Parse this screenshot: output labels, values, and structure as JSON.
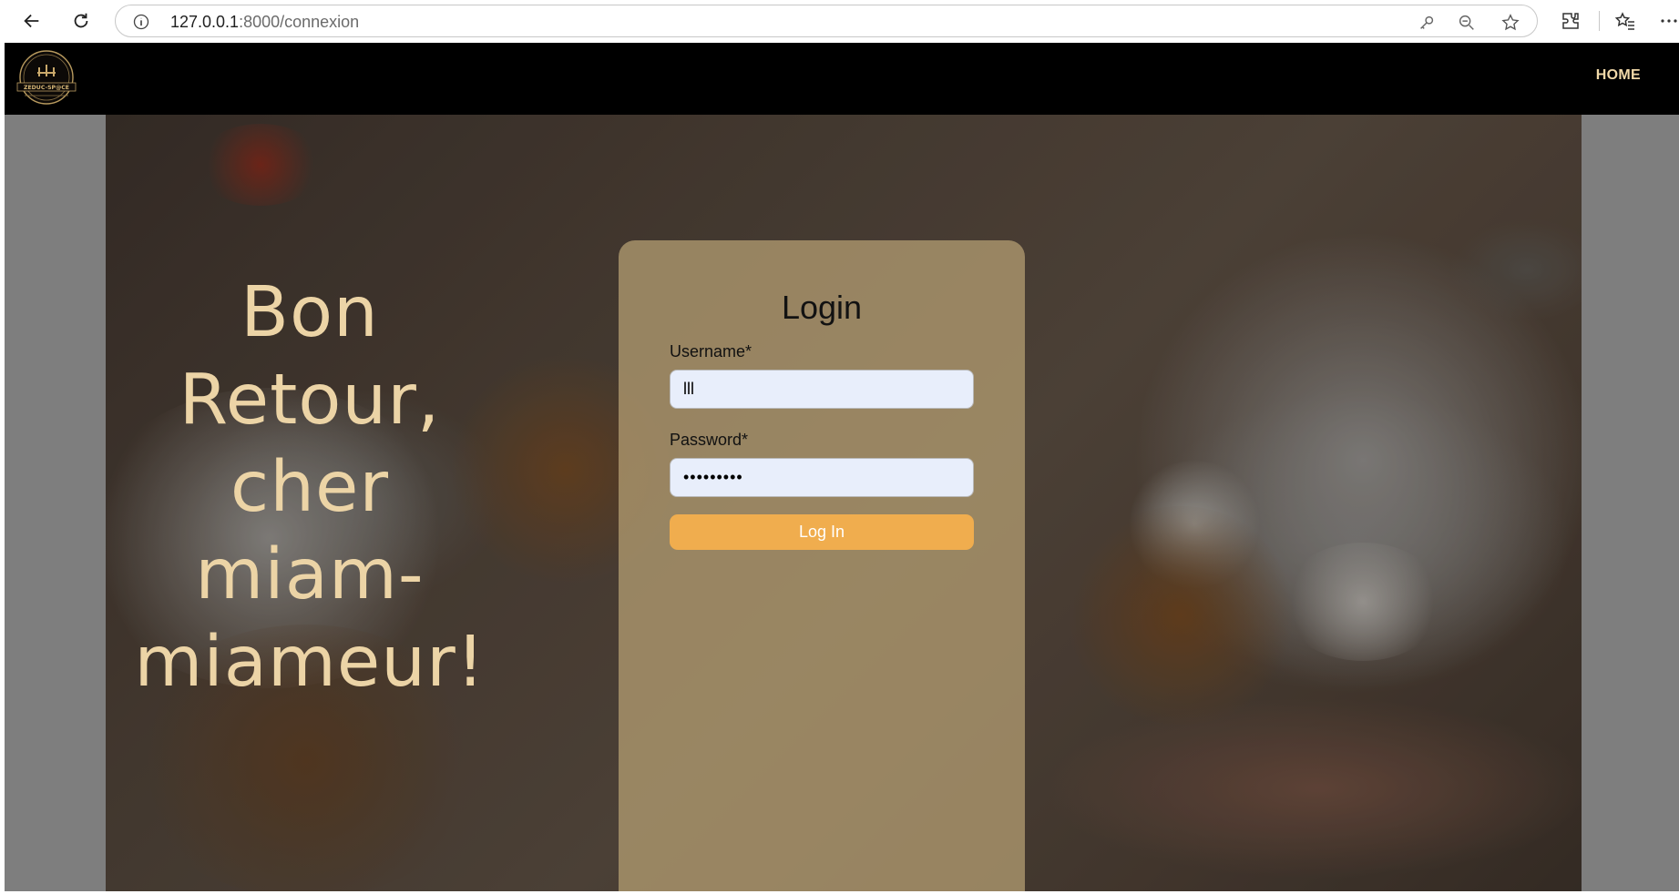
{
  "browser": {
    "url_host": "127.0.0.1",
    "url_path": ":8000/connexion",
    "icons": [
      "back-icon",
      "reload-icon",
      "site-info-icon",
      "key-icon",
      "zoom-out-icon",
      "favorite-star-icon",
      "extensions-icon",
      "favorites-icon",
      "more-icon"
    ]
  },
  "nav": {
    "logo_text": "ZEDUC-SP@CE",
    "home_label": "HOME"
  },
  "hero": {
    "welcome_line1": "Bon Retour,",
    "welcome_line2": "cher miam-",
    "welcome_line3": "miameur!"
  },
  "login": {
    "title": "Login",
    "username_label": "Username*",
    "username_value": "lll",
    "password_label": "Password*",
    "password_value": "•••••••••",
    "submit_label": "Log In"
  },
  "colors": {
    "nav_bg": "#000000",
    "home_link": "#f1d9a8",
    "welcome_text": "#ecd4a6",
    "button": "#f0ad4e",
    "input_bg": "#e8eefb"
  }
}
